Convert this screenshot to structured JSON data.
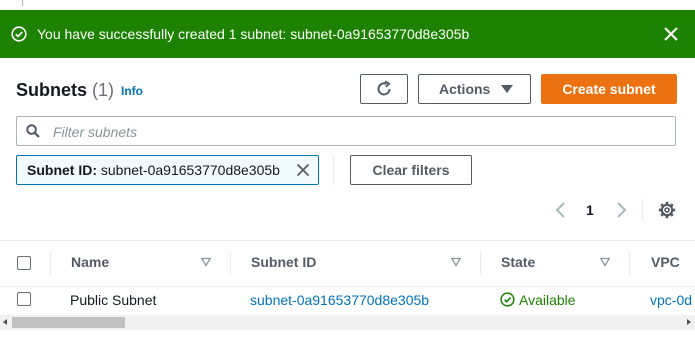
{
  "flash": {
    "message": "You have successfully created 1 subnet: subnet-0a91653770d8e305b",
    "icon": "check-circle-icon",
    "close_icon": "close-icon",
    "color": "#1d8102"
  },
  "header": {
    "title": "Subnets",
    "count": "(1)",
    "info_link": "Info"
  },
  "toolbar": {
    "refresh_icon": "refresh-icon",
    "actions_label": "Actions",
    "create_label": "Create subnet",
    "create_color": "#ec7211"
  },
  "filter": {
    "placeholder": "Filter subnets",
    "value": "",
    "token_key": "Subnet ID:",
    "token_value": "subnet-0a91653770d8e305b",
    "clear_label": "Clear filters"
  },
  "pagination": {
    "current_page": "1"
  },
  "table": {
    "columns": [
      "Name",
      "Subnet ID",
      "State",
      "VPC"
    ],
    "rows": [
      {
        "name": "Public Subnet",
        "subnet_id": "subnet-0a91653770d8e305b",
        "state": "Available",
        "vpc": "vpc-0d"
      }
    ]
  }
}
